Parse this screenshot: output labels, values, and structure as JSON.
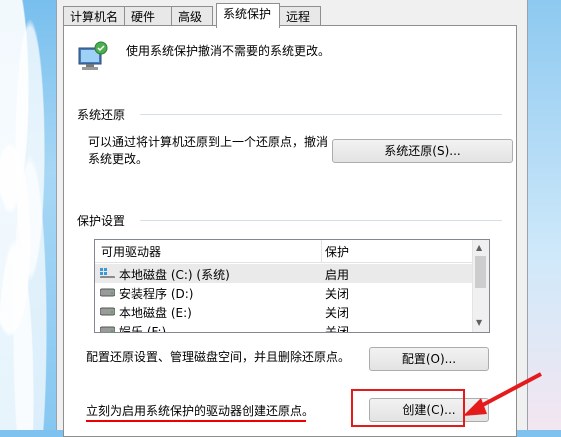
{
  "tabs": [
    "计算机名",
    "硬件",
    "高级",
    "系统保护",
    "远程"
  ],
  "active_tab": "系统保护",
  "intro_text": "使用系统保护撤消不需要的系统更改。",
  "restore_section": {
    "title": "系统还原",
    "description": "可以通过将计算机还原到上一个还原点，撤消系统更改。",
    "description_line1": "可以通过将计算机还原到上一个还原点，撤消",
    "description_line2": "系统更改。",
    "button": "系统还原(S)..."
  },
  "protection_section": {
    "title": "保护设置",
    "columns": [
      "可用驱动器",
      "保护"
    ],
    "drives": [
      {
        "name": "本地磁盘 (C:) (系统)",
        "state": "启用",
        "icon": "system-drive-icon"
      },
      {
        "name": "安装程序 (D:)",
        "state": "关闭",
        "icon": "drive-icon"
      },
      {
        "name": "本地磁盘 (E:)",
        "state": "关闭",
        "icon": "drive-icon"
      },
      {
        "name": "娱乐 (F:)",
        "state": "关闭",
        "icon": "drive-icon"
      }
    ],
    "configure_text": "配置还原设置、管理磁盘空间，并且删除还原点。",
    "configure_button": "配置(O)...",
    "create_text": "立刻为启用系统保护的驱动器创建还原点。",
    "create_button": "创建(C)..."
  },
  "colors": {
    "annotation": "#e51b1b",
    "panel": "#ffffff",
    "dialog": "#f0f0f0"
  }
}
